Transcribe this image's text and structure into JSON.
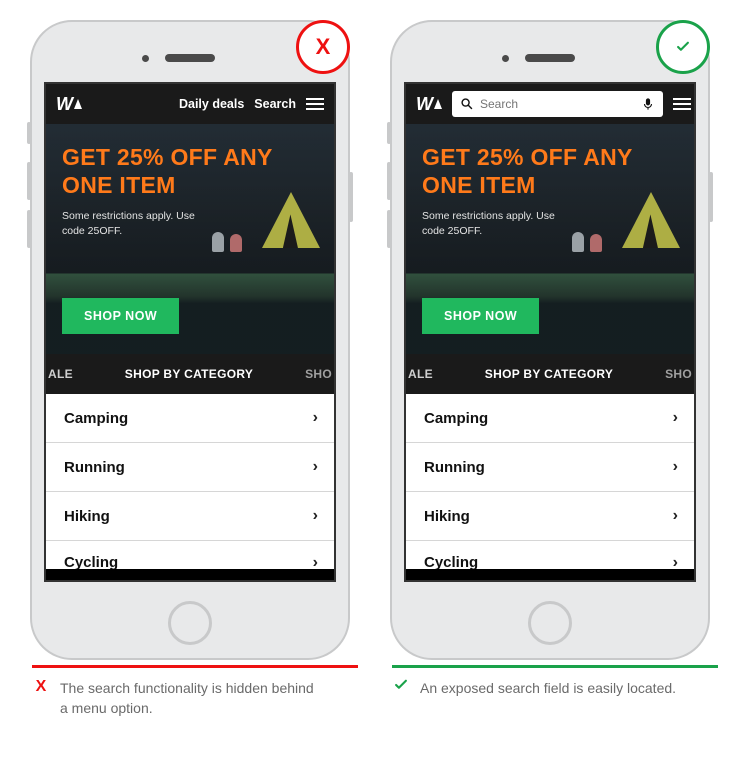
{
  "bad": {
    "badge_mark": "X",
    "topbar": {
      "daily_deals": "Daily deals",
      "search": "Search"
    },
    "hero": {
      "headline": "GET 25% OFF ANY ONE ITEM",
      "sub": "Some restrictions apply. Use code 25OFF.",
      "cta": "SHOP NOW"
    },
    "tabs": {
      "left": "ALE",
      "center": "SHOP BY CATEGORY",
      "right": "SHO"
    },
    "categories": [
      "Camping",
      "Running",
      "Hiking",
      "Cycling"
    ],
    "caption_mark": "X",
    "caption": "The search functionality is hidden behind a menu option."
  },
  "good": {
    "badge_mark": "✓",
    "topbar": {
      "search_placeholder": "Search"
    },
    "hero": {
      "headline": "GET 25% OFF ANY ONE ITEM",
      "sub": "Some restrictions apply. Use code 25OFF.",
      "cta": "SHOP NOW"
    },
    "tabs": {
      "left": "ALE",
      "center": "SHOP BY CATEGORY",
      "right": "SHO"
    },
    "categories": [
      "Camping",
      "Running",
      "Hiking",
      "Cycling"
    ],
    "caption_mark": "✓",
    "caption": "An exposed search field is easily located."
  }
}
